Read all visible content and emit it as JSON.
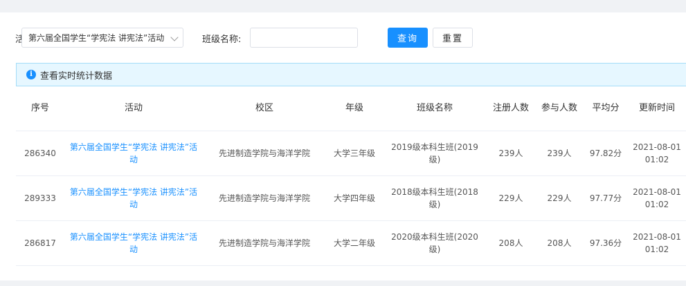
{
  "filters": {
    "activity_label_partial": "活",
    "activity_selected": "第六届全国学生“学宪法 讲宪法”活动",
    "class_label": "班级名称:",
    "class_value": "",
    "query_button": "查询",
    "reset_button": "重置"
  },
  "info": {
    "text": "查看实时统计数据"
  },
  "colors": {
    "primary": "#1890ff",
    "info_bg": "#e6f7ff",
    "info_border": "#a3dcf8"
  },
  "table": {
    "headers": [
      "序号",
      "活动",
      "校区",
      "年级",
      "班级名称",
      "注册人数",
      "参与人数",
      "平均分",
      "更新时间"
    ],
    "rows": [
      {
        "id": "286340",
        "activity": "第六届全国学生“学宪法 讲宪法”活动",
        "campus": "先进制造学院与海洋学院",
        "grade": "大学三年级",
        "class_name": "2019级本科生班(2019级)",
        "registered": "239人",
        "participants": "239人",
        "avg_score": "97.82分",
        "updated": "2021-08-01 01:02"
      },
      {
        "id": "289333",
        "activity": "第六届全国学生“学宪法 讲宪法”活动",
        "campus": "先进制造学院与海洋学院",
        "grade": "大学四年级",
        "class_name": "2018级本科生班(2018级)",
        "registered": "229人",
        "participants": "229人",
        "avg_score": "97.77分",
        "updated": "2021-08-01 01:02"
      },
      {
        "id": "286817",
        "activity": "第六届全国学生“学宪法 讲宪法”活动",
        "campus": "先进制造学院与海洋学院",
        "grade": "大学二年级",
        "class_name": "2020级本科生班(2020级)",
        "registered": "208人",
        "participants": "208人",
        "avg_score": "97.36分",
        "updated": "2021-08-01 01:02"
      }
    ]
  }
}
